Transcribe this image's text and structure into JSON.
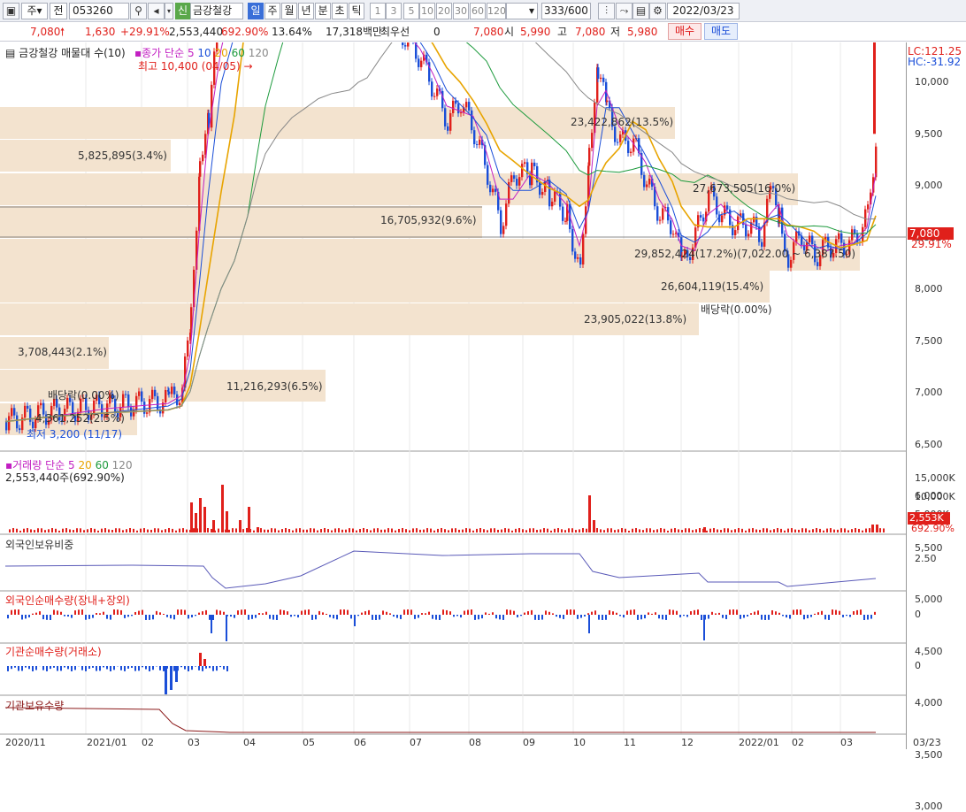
{
  "toolbar": {
    "period": "주",
    "prev": "전",
    "code": "053260",
    "stock_name": "금강철강",
    "period_tabs": [
      "일",
      "주",
      "월",
      "년",
      "분",
      "초",
      "틱"
    ],
    "intervals": [
      "1",
      "3",
      "5",
      "10",
      "20",
      "30",
      "60",
      "120"
    ],
    "count": "333",
    "count_total": "/600",
    "date": "2022/03/23"
  },
  "quote": {
    "price": "7,080",
    "change": "1,630",
    "change_pct": "+29.91%",
    "volume": "2,553,440",
    "vol_ratio": "692.90%",
    "turnover": "13.64%",
    "amount": "17,318백만",
    "pref_label": "최우선",
    "pref_value": "0",
    "bid": "7,080",
    "open_label": "시",
    "open": "5,990",
    "high_label": "고",
    "high": "7,080",
    "low_label": "저",
    "low": "5,980",
    "buy": "매수",
    "sell": "매도"
  },
  "price_panel": {
    "title": "금강철강 매물대 수(10)",
    "ma_title": "종가 단순",
    "ma_periods": [
      "5",
      "10",
      "20",
      "60",
      "120"
    ],
    "max_label": "최고 10,400 (04/05)",
    "min_label": "최저 3,200 (11/17)",
    "dividend_label_1": "배당락(0.00%)",
    "dividend_label_2": "배당락(0.00%)",
    "lc": "LC:121.25",
    "hc": "HC:-31.92",
    "current_price": "7,080",
    "current_pct": "29.91%",
    "volume_profile": [
      "23,422,862(13.5%)",
      "5,825,895(3.4%)",
      "27,673,505(16.0%)",
      "16,705,932(9.6%)",
      "29,852,424(17.2%)(7,022.00 ~ 6,387.50)",
      "26,604,119(15.4%)",
      "23,905,022(13.8%)",
      "3,708,443(2.1%)",
      "11,216,293(6.5%)",
      "4,361,252(2.5%)"
    ],
    "yticks": [
      "10,000",
      "9,500",
      "9,000",
      "8,500",
      "8,000",
      "7,500",
      "7,000",
      "6,500",
      "6,000",
      "5,500",
      "5,000",
      "4,500",
      "4,000",
      "3,500",
      "3,000"
    ]
  },
  "volume_panel": {
    "title": "거래량 단순",
    "ma_periods": [
      "5",
      "20",
      "60",
      "120"
    ],
    "value": "2,553,440주(692.90%)",
    "yticks": [
      "15,000K",
      "10,000K",
      "5,000K"
    ],
    "current": "2,553K",
    "current_pct": "692.90%"
  },
  "foreign_ratio": {
    "title": "외국인보유비중",
    "ytick": "2.50"
  },
  "foreign_net": {
    "title": "외국인순매수량(장내+장외)",
    "ytick": "0"
  },
  "inst_net": {
    "title": "기관순매수량(거래소)",
    "ytick": "0"
  },
  "inst_hold": {
    "title": "기관보유수량"
  },
  "xaxis": [
    "2020/11",
    "2021/01",
    "02",
    "03",
    "04",
    "05",
    "06",
    "07",
    "08",
    "09",
    "10",
    "11",
    "12",
    "2022/01",
    "02",
    "03",
    "03/23"
  ],
  "colors": {
    "up": "#e0201b",
    "down": "#1a4ed8",
    "ma5": "#c21fc2",
    "ma10": "#1a4ed8",
    "ma20": "#e8a400",
    "ma60": "#1c9a3c",
    "ma120": "#888888",
    "profile": "#f3e3cf"
  }
}
